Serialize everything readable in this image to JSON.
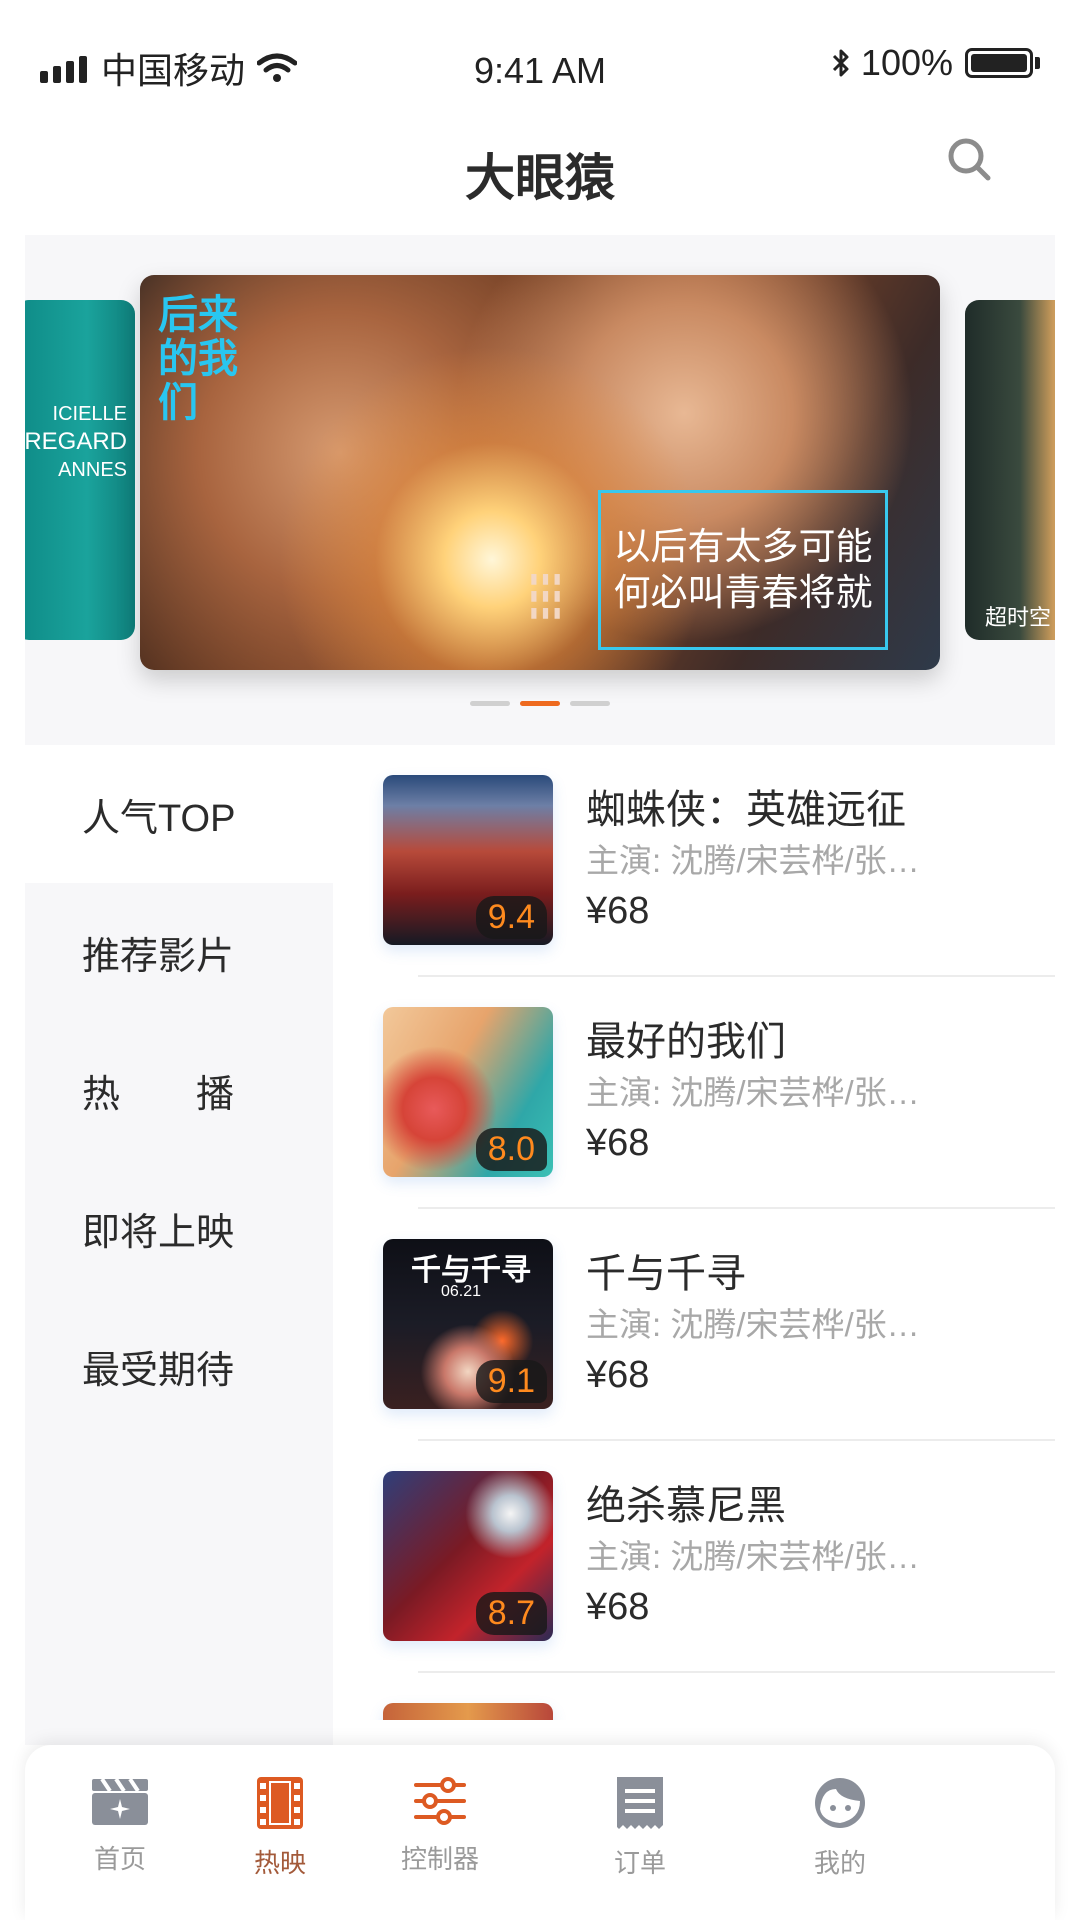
{
  "status_bar": {
    "carrier": "中国移动",
    "time": "9:41 AM",
    "battery": "100%"
  },
  "header": {
    "title": "大眼猿"
  },
  "banner": {
    "left_card_text": [
      "ICIELLE",
      "REGARD",
      "ANNES"
    ],
    "main_card": {
      "poster_title": "后来的我们",
      "quote_line1": "以后有太多可能",
      "quote_line2": "何必叫青春将就"
    },
    "right_card_text": "超时空",
    "active_index": 1,
    "page_count": 3
  },
  "categories": [
    {
      "label": "人气TOP"
    },
    {
      "label": "推荐影片"
    },
    {
      "label": "热　　播"
    },
    {
      "label": "即将上映"
    },
    {
      "label": "最受期待"
    }
  ],
  "active_category": 0,
  "movies": [
    {
      "title": "蜘蛛侠：英雄远征",
      "cast": "主演: 沈腾/宋芸桦/张…",
      "price": "¥68",
      "rating": "9.4"
    },
    {
      "title": "最好的我们",
      "cast": "主演: 沈腾/宋芸桦/张…",
      "price": "¥68",
      "rating": "8.0"
    },
    {
      "title": "千与千寻",
      "cast": "主演: 沈腾/宋芸桦/张…",
      "price": "¥68",
      "rating": "9.1",
      "poster_text": "千与千寻",
      "poster_date": "06.21"
    },
    {
      "title": "绝杀慕尼黑",
      "cast": "主演: 沈腾/宋芸桦/张…",
      "price": "¥68",
      "rating": "8.7"
    }
  ],
  "tabs": [
    {
      "label": "首页",
      "icon": "clapperboard-icon"
    },
    {
      "label": "热映",
      "icon": "film-strip-icon"
    },
    {
      "label": "控制器",
      "icon": "sliders-icon"
    },
    {
      "label": "订单",
      "icon": "ticket-icon"
    },
    {
      "label": "我的",
      "icon": "face-icon"
    }
  ],
  "active_tab": 1,
  "colors": {
    "accent": "#ee6a1f",
    "rating": "#ff8a1e",
    "tab_active": "#dd5a22",
    "tab_inactive": "#8a8f99"
  }
}
